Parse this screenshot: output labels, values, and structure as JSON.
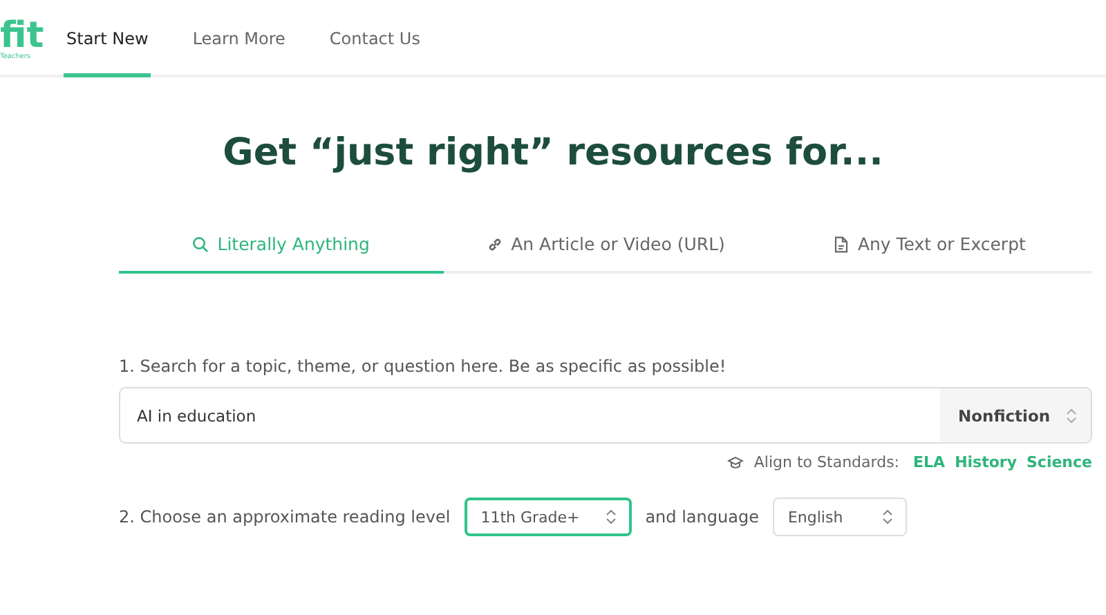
{
  "logo": {
    "mark": "fit",
    "sub": "Teachers"
  },
  "nav": [
    {
      "label": "Start New",
      "selected": true
    },
    {
      "label": "Learn More",
      "selected": false
    },
    {
      "label": "Contact Us",
      "selected": false
    }
  ],
  "heading": "Get “just right” resources for...",
  "tabs": [
    {
      "label": "Literally Anything",
      "kind": "search",
      "selected": true
    },
    {
      "label": "An Article or Video (URL)",
      "kind": "link",
      "selected": false
    },
    {
      "label": "Any Text or Excerpt",
      "kind": "document",
      "selected": false
    }
  ],
  "search_label": "1. Search for a topic, theme, or question here. Be as specific as possible!",
  "search": {
    "value": "AI in education",
    "genre": "Nonfiction"
  },
  "standards": {
    "label": "Align to Standards:",
    "links": [
      "ELA",
      "History",
      "Science"
    ]
  },
  "level_label": "2. Choose an approximate reading level",
  "level": {
    "value": "11th Grade+",
    "focused": true
  },
  "language_label": "and language",
  "language": {
    "value": "English",
    "focused": false
  }
}
